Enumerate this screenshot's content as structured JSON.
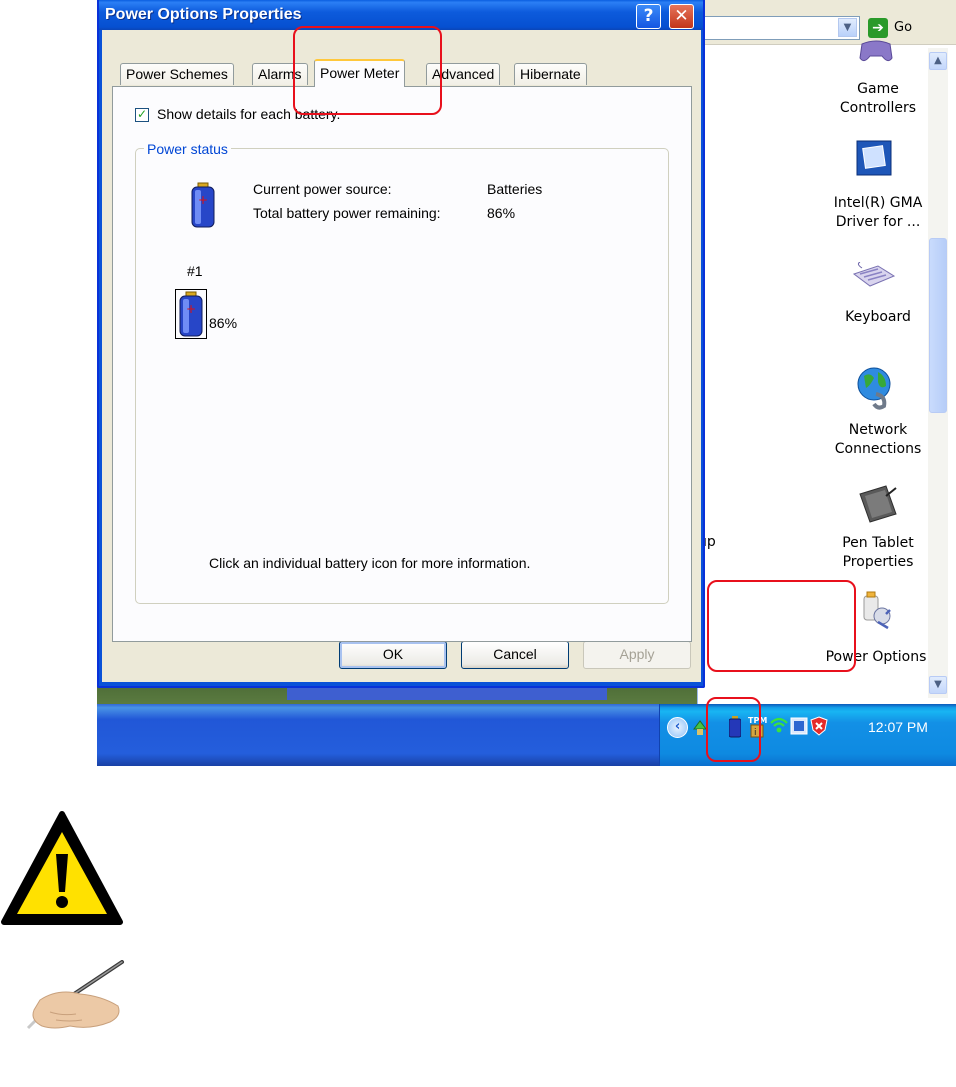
{
  "dialog": {
    "title": "Power Options Properties",
    "help_glyph": "?",
    "close_glyph": "✕",
    "tabs": [
      {
        "label": "Power Schemes",
        "active": false
      },
      {
        "label": "Alarms",
        "active": false
      },
      {
        "label": "Power Meter",
        "active": true
      },
      {
        "label": "Advanced",
        "active": false
      },
      {
        "label": "Hibernate",
        "active": false
      }
    ],
    "show_details": {
      "label": "Show details for each battery.",
      "checked": true
    },
    "power_status": {
      "group_label": "Power status",
      "source_label": "Current power source:",
      "source_value": "Batteries",
      "remaining_label": "Total battery power remaining:",
      "remaining_value": "86%"
    },
    "battery": {
      "label": "#1",
      "percent": "86%",
      "level": 0.86
    },
    "hint": "Click an individual battery icon for more information.",
    "buttons": {
      "ok": "OK",
      "cancel": "Cancel",
      "apply": "Apply"
    }
  },
  "explorer": {
    "go_label": "Go",
    "items": [
      {
        "label": "Game\nControllers",
        "icon": "game-controller-icon"
      },
      {
        "label": "Intel(R) GMA\nDriver for ...",
        "icon": "intel-gma-icon"
      },
      {
        "label": "Keyboard",
        "icon": "keyboard-icon"
      },
      {
        "label": "Network\nConnections",
        "icon": "network-globe-icon"
      },
      {
        "label": "Pen Tablet\nProperties",
        "icon": "pen-tablet-icon"
      },
      {
        "label": "Power Options",
        "icon": "power-options-icon"
      }
    ],
    "partial_label": "up"
  },
  "taskbar": {
    "clock": "12:07 PM",
    "tray_icons": [
      "show-hidden-icons-arrow",
      "safely-remove-icon",
      "battery-icon",
      "tpm-icon",
      "wireless-icon",
      "network-monitor-icon",
      "security-shield-icon"
    ]
  },
  "annotations": {
    "highlight_color": "#e8101c",
    "highlights": [
      "power-meter-tab",
      "power-options-item",
      "tray-battery-icon"
    ]
  },
  "side_icons": [
    "warning-triangle-icon",
    "pen-hand-icon"
  ]
}
